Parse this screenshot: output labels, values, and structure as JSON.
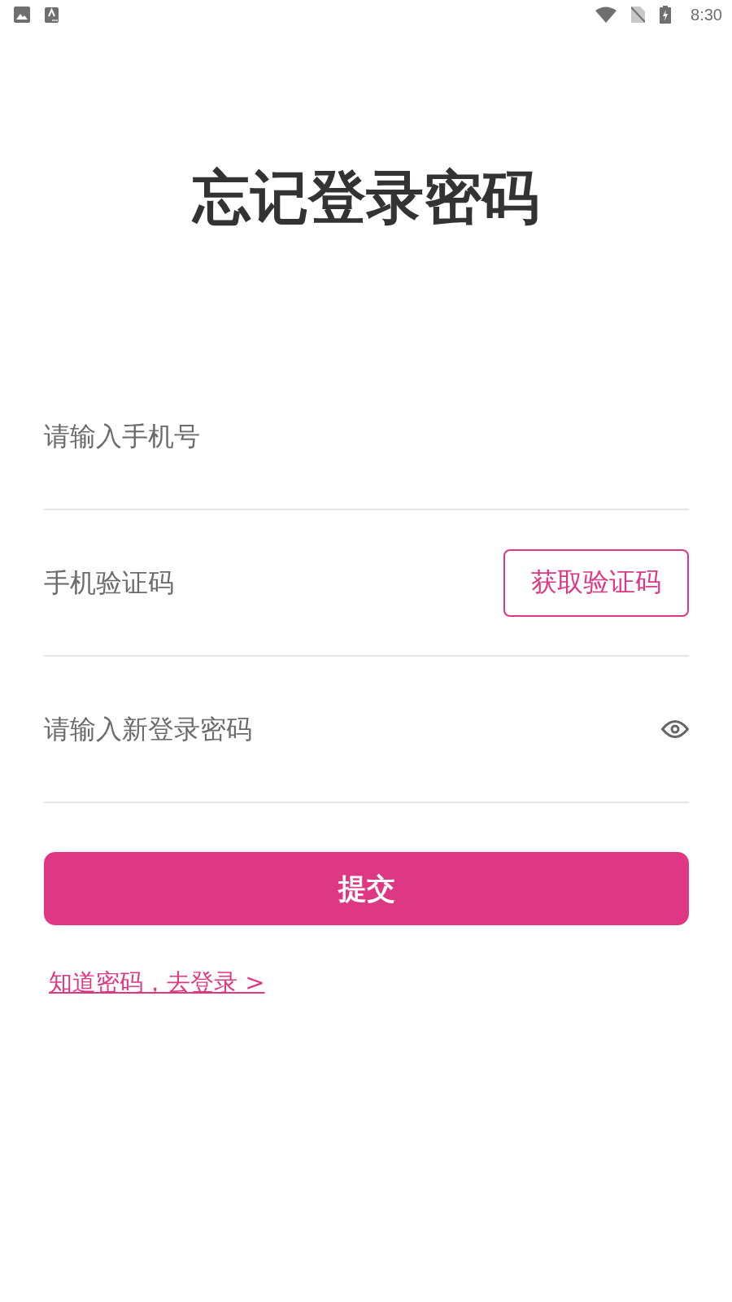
{
  "status_bar": {
    "time": "8:30"
  },
  "title": "忘记登录密码",
  "form": {
    "fields": [
      {
        "kind": "plain",
        "placeholder": "请输入手机号"
      },
      {
        "kind": "with_button",
        "placeholder": "手机验证码",
        "button": "获取验证码"
      },
      {
        "kind": "with_toggle",
        "placeholder": "请输入新登录密码"
      }
    ],
    "submit": "提交"
  },
  "login_link": "知道密码，去登录 >"
}
